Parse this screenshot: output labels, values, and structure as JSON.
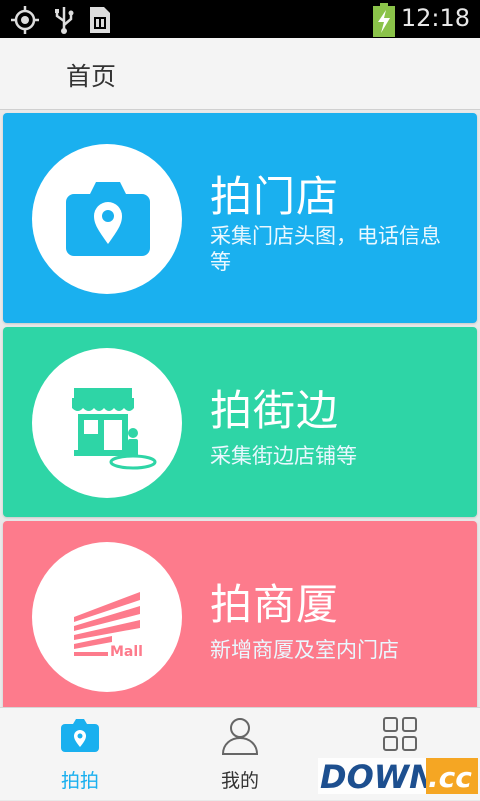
{
  "status_bar": {
    "time": "12:18",
    "icons": [
      "gps-icon",
      "usb-icon",
      "sd-card-icon",
      "battery-charging-icon"
    ]
  },
  "header": {
    "title": "首页"
  },
  "cards": [
    {
      "title": "拍门店",
      "desc": "采集门店头图，电话信息等",
      "color": "#1ab0ef",
      "icon": "camera-location-icon"
    },
    {
      "title": "拍街边",
      "desc": "采集街边店铺等",
      "color": "#2ed5a6",
      "icon": "storefront-icon"
    },
    {
      "title": "拍商厦",
      "desc": "新增商厦及室内门店",
      "color": "#fd7b8c",
      "icon": "mall-icon",
      "icon_text": "Mall"
    }
  ],
  "bottom_nav": {
    "items": [
      {
        "label": "拍拍",
        "icon": "camera-location-icon",
        "active": true
      },
      {
        "label": "我的",
        "icon": "user-icon",
        "active": false
      },
      {
        "label": "",
        "icon": "grid-icon",
        "active": false
      }
    ],
    "active_color": "#1ab0ef",
    "inactive_color": "#333333"
  },
  "watermark": {
    "text_main": "DOWN",
    "text_suffix": ".cc"
  }
}
